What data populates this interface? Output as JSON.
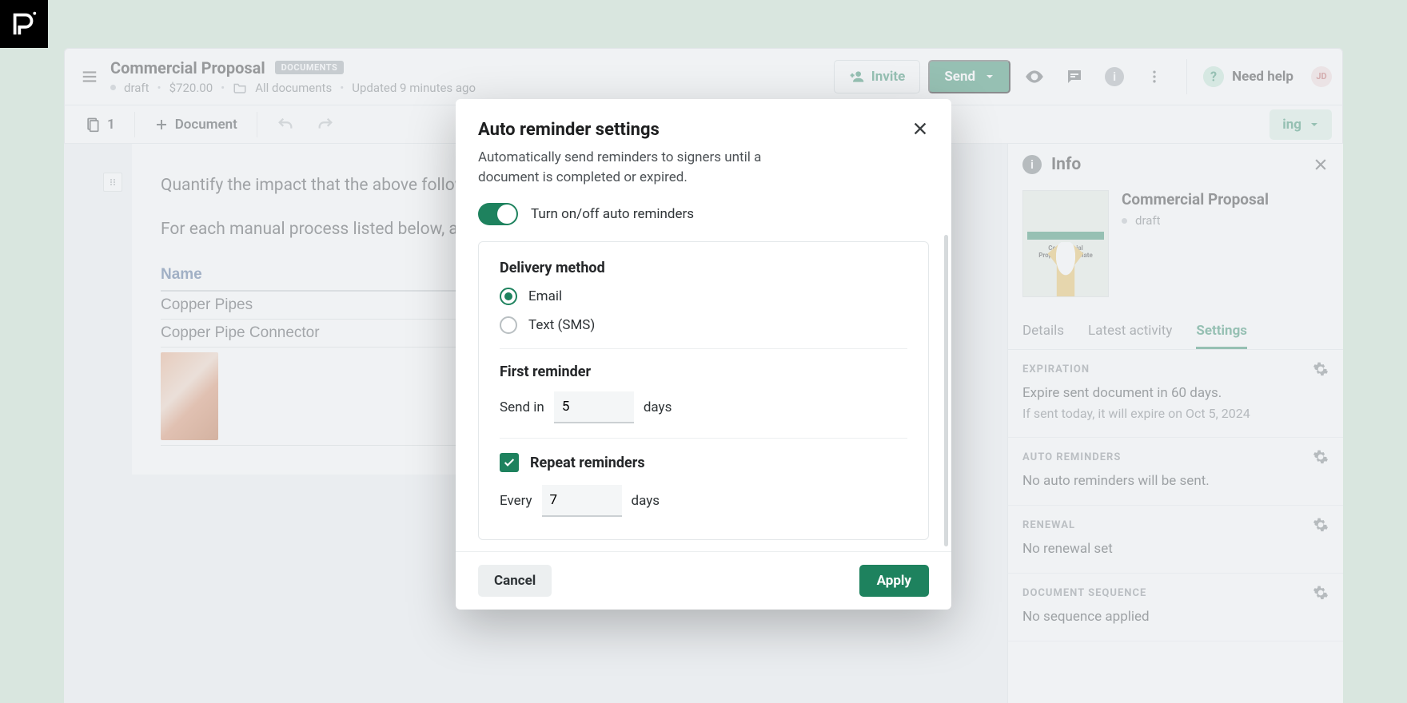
{
  "titlebar": {
    "title": "Commercial Proposal",
    "badge": "DOCUMENTS",
    "status": "draft",
    "amount": "$720.00",
    "folder": "All documents",
    "updated": "Updated 9 minutes ago",
    "invite": "Invite",
    "send": "Send",
    "help": "Need help",
    "avatar": "JD"
  },
  "toolbar": {
    "pages": "1",
    "document": "Document",
    "design_chip_suffix": "ing"
  },
  "editor": {
    "p1": "Quantify the impact that the above follows.",
    "p2": "For each manual process listed below, at each step. This equates to a loss in",
    "col_name": "Name",
    "row1": "Copper Pipes",
    "row2": "Copper Pipe Connector"
  },
  "info": {
    "heading": "Info",
    "doc_title": "Commercial Proposal",
    "doc_status": "draft",
    "thumb_line1": "Commercial",
    "thumb_line2": "Proposal Template",
    "tabs": {
      "details": "Details",
      "activity": "Latest activity",
      "settings": "Settings"
    },
    "expiration": {
      "label": "EXPIRATION",
      "line1": "Expire sent document in 60 days.",
      "line2": "If sent today, it will expire on Oct 5, 2024"
    },
    "auto_reminders": {
      "label": "AUTO REMINDERS",
      "line": "No auto reminders will be sent."
    },
    "renewal": {
      "label": "RENEWAL",
      "line": "No renewal set"
    },
    "sequence": {
      "label": "DOCUMENT SEQUENCE",
      "line": "No sequence applied"
    }
  },
  "modal": {
    "title": "Auto reminder settings",
    "subtitle": "Automatically send reminders to signers until a document is completed or expired.",
    "toggle_label": "Turn on/off auto reminders",
    "delivery_label": "Delivery method",
    "opt_email": "Email",
    "opt_sms": "Text (SMS)",
    "first_label": "First reminder",
    "first_prefix": "Send in",
    "first_value": "5",
    "first_suffix": "days",
    "repeat_label": "Repeat reminders",
    "repeat_prefix": "Every",
    "repeat_value": "7",
    "repeat_suffix": "days",
    "cancel": "Cancel",
    "apply": "Apply"
  }
}
